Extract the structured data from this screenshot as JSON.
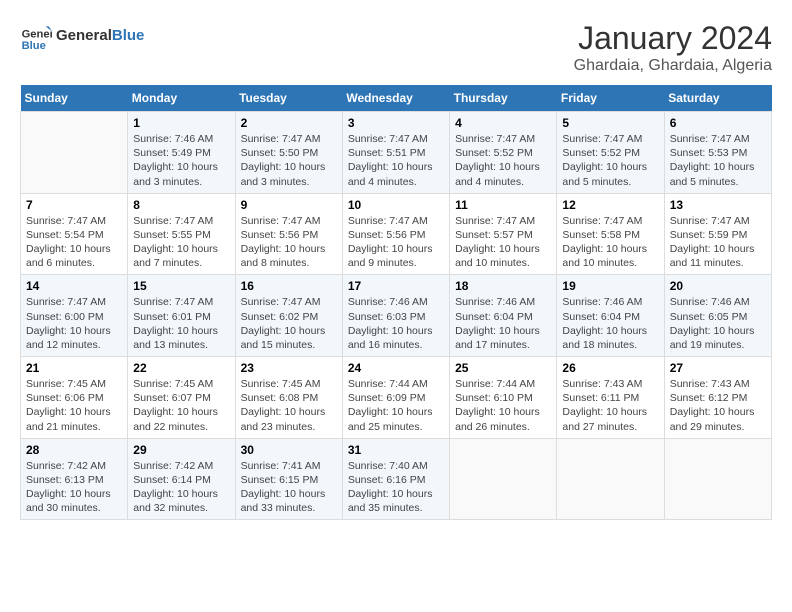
{
  "logo": {
    "line1": "General",
    "line2": "Blue"
  },
  "title": "January 2024",
  "subtitle": "Ghardaia, Ghardaia, Algeria",
  "weekdays": [
    "Sunday",
    "Monday",
    "Tuesday",
    "Wednesday",
    "Thursday",
    "Friday",
    "Saturday"
  ],
  "weeks": [
    [
      {
        "day": "",
        "info": ""
      },
      {
        "day": "1",
        "info": "Sunrise: 7:46 AM\nSunset: 5:49 PM\nDaylight: 10 hours\nand 3 minutes."
      },
      {
        "day": "2",
        "info": "Sunrise: 7:47 AM\nSunset: 5:50 PM\nDaylight: 10 hours\nand 3 minutes."
      },
      {
        "day": "3",
        "info": "Sunrise: 7:47 AM\nSunset: 5:51 PM\nDaylight: 10 hours\nand 4 minutes."
      },
      {
        "day": "4",
        "info": "Sunrise: 7:47 AM\nSunset: 5:52 PM\nDaylight: 10 hours\nand 4 minutes."
      },
      {
        "day": "5",
        "info": "Sunrise: 7:47 AM\nSunset: 5:52 PM\nDaylight: 10 hours\nand 5 minutes."
      },
      {
        "day": "6",
        "info": "Sunrise: 7:47 AM\nSunset: 5:53 PM\nDaylight: 10 hours\nand 5 minutes."
      }
    ],
    [
      {
        "day": "7",
        "info": "Sunrise: 7:47 AM\nSunset: 5:54 PM\nDaylight: 10 hours\nand 6 minutes."
      },
      {
        "day": "8",
        "info": "Sunrise: 7:47 AM\nSunset: 5:55 PM\nDaylight: 10 hours\nand 7 minutes."
      },
      {
        "day": "9",
        "info": "Sunrise: 7:47 AM\nSunset: 5:56 PM\nDaylight: 10 hours\nand 8 minutes."
      },
      {
        "day": "10",
        "info": "Sunrise: 7:47 AM\nSunset: 5:56 PM\nDaylight: 10 hours\nand 9 minutes."
      },
      {
        "day": "11",
        "info": "Sunrise: 7:47 AM\nSunset: 5:57 PM\nDaylight: 10 hours\nand 10 minutes."
      },
      {
        "day": "12",
        "info": "Sunrise: 7:47 AM\nSunset: 5:58 PM\nDaylight: 10 hours\nand 10 minutes."
      },
      {
        "day": "13",
        "info": "Sunrise: 7:47 AM\nSunset: 5:59 PM\nDaylight: 10 hours\nand 11 minutes."
      }
    ],
    [
      {
        "day": "14",
        "info": "Sunrise: 7:47 AM\nSunset: 6:00 PM\nDaylight: 10 hours\nand 12 minutes."
      },
      {
        "day": "15",
        "info": "Sunrise: 7:47 AM\nSunset: 6:01 PM\nDaylight: 10 hours\nand 13 minutes."
      },
      {
        "day": "16",
        "info": "Sunrise: 7:47 AM\nSunset: 6:02 PM\nDaylight: 10 hours\nand 15 minutes."
      },
      {
        "day": "17",
        "info": "Sunrise: 7:46 AM\nSunset: 6:03 PM\nDaylight: 10 hours\nand 16 minutes."
      },
      {
        "day": "18",
        "info": "Sunrise: 7:46 AM\nSunset: 6:04 PM\nDaylight: 10 hours\nand 17 minutes."
      },
      {
        "day": "19",
        "info": "Sunrise: 7:46 AM\nSunset: 6:04 PM\nDaylight: 10 hours\nand 18 minutes."
      },
      {
        "day": "20",
        "info": "Sunrise: 7:46 AM\nSunset: 6:05 PM\nDaylight: 10 hours\nand 19 minutes."
      }
    ],
    [
      {
        "day": "21",
        "info": "Sunrise: 7:45 AM\nSunset: 6:06 PM\nDaylight: 10 hours\nand 21 minutes."
      },
      {
        "day": "22",
        "info": "Sunrise: 7:45 AM\nSunset: 6:07 PM\nDaylight: 10 hours\nand 22 minutes."
      },
      {
        "day": "23",
        "info": "Sunrise: 7:45 AM\nSunset: 6:08 PM\nDaylight: 10 hours\nand 23 minutes."
      },
      {
        "day": "24",
        "info": "Sunrise: 7:44 AM\nSunset: 6:09 PM\nDaylight: 10 hours\nand 25 minutes."
      },
      {
        "day": "25",
        "info": "Sunrise: 7:44 AM\nSunset: 6:10 PM\nDaylight: 10 hours\nand 26 minutes."
      },
      {
        "day": "26",
        "info": "Sunrise: 7:43 AM\nSunset: 6:11 PM\nDaylight: 10 hours\nand 27 minutes."
      },
      {
        "day": "27",
        "info": "Sunrise: 7:43 AM\nSunset: 6:12 PM\nDaylight: 10 hours\nand 29 minutes."
      }
    ],
    [
      {
        "day": "28",
        "info": "Sunrise: 7:42 AM\nSunset: 6:13 PM\nDaylight: 10 hours\nand 30 minutes."
      },
      {
        "day": "29",
        "info": "Sunrise: 7:42 AM\nSunset: 6:14 PM\nDaylight: 10 hours\nand 32 minutes."
      },
      {
        "day": "30",
        "info": "Sunrise: 7:41 AM\nSunset: 6:15 PM\nDaylight: 10 hours\nand 33 minutes."
      },
      {
        "day": "31",
        "info": "Sunrise: 7:40 AM\nSunset: 6:16 PM\nDaylight: 10 hours\nand 35 minutes."
      },
      {
        "day": "",
        "info": ""
      },
      {
        "day": "",
        "info": ""
      },
      {
        "day": "",
        "info": ""
      }
    ]
  ]
}
